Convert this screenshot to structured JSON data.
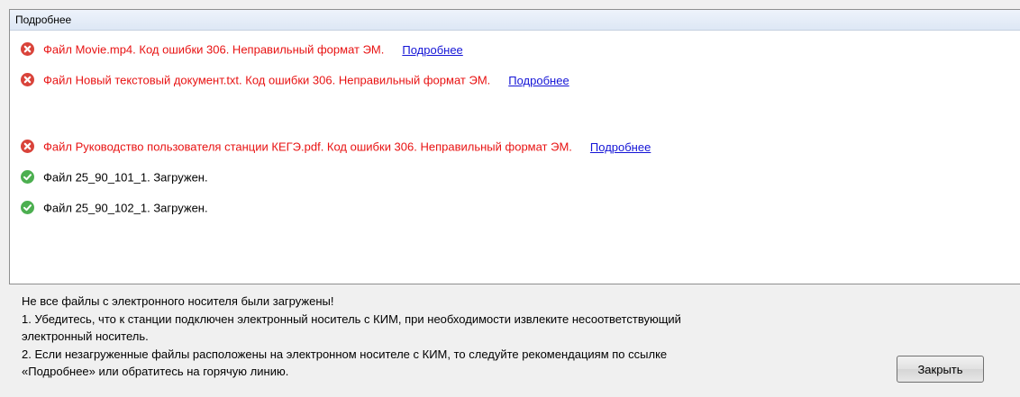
{
  "panel": {
    "title": "Подробнее"
  },
  "log": [
    {
      "status": "error",
      "icon": "error-icon",
      "text": "Файл Movie.mp4. Код ошибки 306. Неправильный формат ЭМ.",
      "link": "Подробнее"
    },
    {
      "status": "error",
      "icon": "error-icon",
      "text": "Файл Новый текстовый документ.txt. Код ошибки 306. Неправильный формат ЭМ.",
      "link": "Подробнее"
    },
    {
      "status": "error",
      "icon": "error-icon",
      "text": "Файл Руководство пользователя станции КЕГЭ.pdf. Код ошибки 306. Неправильный формат ЭМ.",
      "link": "Подробнее"
    },
    {
      "status": "ok",
      "icon": "success-icon",
      "text": "Файл 25_90_101_1. Загружен."
    },
    {
      "status": "ok",
      "icon": "success-icon",
      "text": "Файл 25_90_102_1. Загружен."
    }
  ],
  "info": {
    "line1": "Не все файлы с электронного носителя были загружены!",
    "line2": "1. Убедитесь, что к станции подключен электронный носитель с КИМ, при необходимости извлеките несоответствующий",
    "line3": "электронный носитель.",
    "line4": "2. Если незагруженные файлы расположены на электронном носителе с КИМ, то следуйте рекомендациям по ссылке",
    "line5": "«Подробнее» или обратитесь на горячую линию."
  },
  "buttons": {
    "close_label": "Закрыть"
  },
  "colors": {
    "error": "#e81212",
    "link": "#1414d6",
    "error_icon": "#d9433a",
    "success_icon": "#4caf50"
  }
}
